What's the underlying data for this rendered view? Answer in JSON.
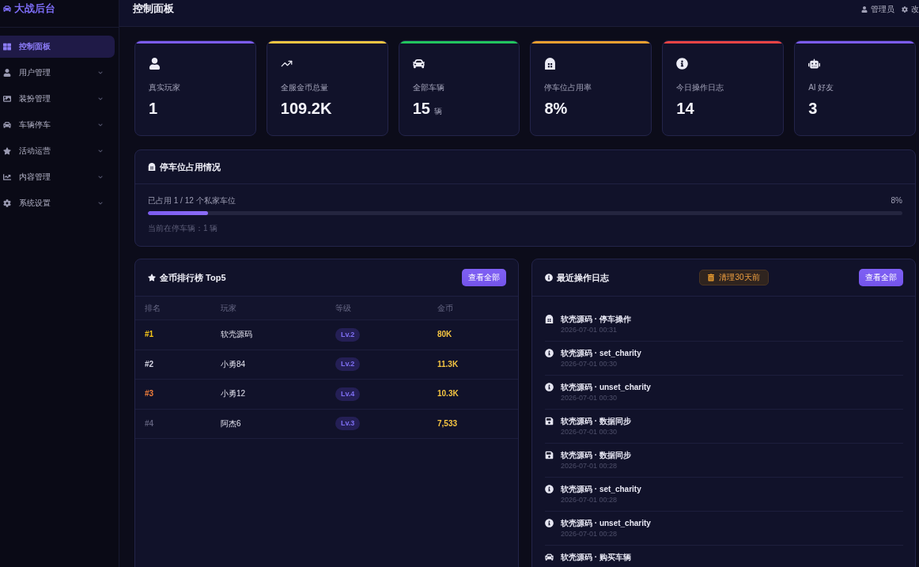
{
  "sidebar": {
    "brand": "大战后台",
    "items": [
      {
        "label": "控制面板",
        "kind": "link",
        "selected": true
      },
      {
        "label": "用户管理",
        "kind": "group",
        "selected": false
      },
      {
        "label": "装扮管理",
        "kind": "group",
        "selected": false
      },
      {
        "label": "车辆停车",
        "kind": "group",
        "selected": false
      },
      {
        "label": "活动运营",
        "kind": "group",
        "selected": false
      },
      {
        "label": "内容管理",
        "kind": "group",
        "selected": false
      },
      {
        "label": "系统设置",
        "kind": "group",
        "selected": false
      }
    ]
  },
  "header": {
    "title": "控制面板",
    "actions": [
      {
        "label": "管理员"
      },
      {
        "label": "改"
      }
    ]
  },
  "stats": [
    {
      "label": "真实玩家",
      "value": "1",
      "color": "#7c5cf0"
    },
    {
      "label": "全服金币总量",
      "value": "109.2K",
      "color": "#f5c542"
    },
    {
      "label": "全部车辆",
      "value": "15",
      "unit": "辆",
      "color": "#22c55e"
    },
    {
      "label": "停车位占用率",
      "value": "8%",
      "color": "#f0a030"
    },
    {
      "label": "今日操作日志",
      "value": "14",
      "color": "#ef4444"
    },
    {
      "label": "AI 好友",
      "value": "3",
      "color": "#7c5cf0"
    }
  ],
  "parking": {
    "title": "停车位占用情况",
    "summary": "已占用 1 / 12 个私家车位",
    "percent": "8%",
    "level": 0.08,
    "note": "当前在停车辆：1 辆"
  },
  "leaderboard": {
    "title": "金币排行榜 Top5",
    "button": "查看全部",
    "columns": [
      "排名",
      "玩家",
      "等级",
      "金币"
    ],
    "rows": [
      {
        "rank": "#1",
        "color": "#f5c518",
        "player": "软壳源码",
        "grade": "Lv.2",
        "coins": "80K"
      },
      {
        "rank": "#2",
        "color": "#d4d4e2",
        "player": "小勇84",
        "grade": "Lv.2",
        "coins": "11.3K"
      },
      {
        "rank": "#3",
        "color": "#f07d3a",
        "player": "小勇12",
        "grade": "Lv.4",
        "coins": "10.3K"
      },
      {
        "rank": "#4",
        "color": "#5e5e7a",
        "player": "阿杰6",
        "grade": "Lv.3",
        "coins": "7,533"
      }
    ]
  },
  "logs": {
    "title": "最近操作日志",
    "cleanup": "清理30天前",
    "button": "查看全部",
    "entries": [
      {
        "kind": "parking",
        "text": "软壳源码 · 停车操作",
        "time": "2026-07-01 00:31"
      },
      {
        "kind": "info",
        "text": "软壳源码 · set_charity",
        "time": "2026-07-01 00:30"
      },
      {
        "kind": "info",
        "text": "软壳源码 · unset_charity",
        "time": "2026-07-01 00:30"
      },
      {
        "kind": "save",
        "text": "软壳源码 · 数据同步",
        "time": "2026-07-01 00:30"
      },
      {
        "kind": "save",
        "text": "软壳源码 · 数据同步",
        "time": "2026-07-01 00:28"
      },
      {
        "kind": "info",
        "text": "软壳源码 · set_charity",
        "time": "2026-07-01 00:28"
      },
      {
        "kind": "info",
        "text": "软壳源码 · unset_charity",
        "time": "2026-07-01 00:28"
      },
      {
        "kind": "car",
        "text": "软壳源码 · 购买车辆"
      }
    ]
  }
}
